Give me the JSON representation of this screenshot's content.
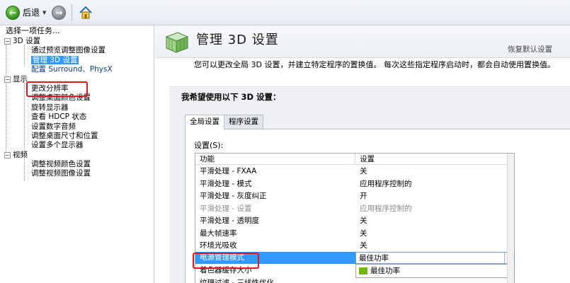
{
  "toolbar": {
    "back_label": "后退",
    "back_icon": "back-arrow-icon",
    "forward_icon": "forward-arrow-icon",
    "home_icon": "home-icon"
  },
  "left_panel": {
    "header": "选择一项任务...",
    "tree": [
      {
        "label": "3D 设置",
        "level": 0,
        "toggle": "−"
      },
      {
        "label": "通过预览调整图像设置",
        "level": 1
      },
      {
        "label": "管理 3D 设置",
        "level": 1,
        "selected": true
      },
      {
        "label": "配置 Surround、PhysX",
        "level": 1
      },
      {
        "label": "显示",
        "level": 0,
        "toggle": "−"
      },
      {
        "label": "更改分辨率",
        "level": 1
      },
      {
        "label": "调整桌面颜色设置",
        "level": 1
      },
      {
        "label": "旋转显示器",
        "level": 1
      },
      {
        "label": "查看 HDCP 状态",
        "level": 1
      },
      {
        "label": "设置数字音频",
        "level": 1
      },
      {
        "label": "调整桌面尺寸和位置",
        "level": 1
      },
      {
        "label": "设置多个显示器",
        "level": 1
      },
      {
        "label": "视频",
        "level": 0,
        "toggle": "−"
      },
      {
        "label": "调整视频颜色设置",
        "level": 1
      },
      {
        "label": "调整视频图像设置",
        "level": 1
      }
    ]
  },
  "right_panel": {
    "title": "管理 3D 设置",
    "restore_label": "恢复默认设置",
    "description": "您可以更改全局 3D 设置，并建立特定程序的置换值。 每次这些指定程序启动时，都会自动使用置换值。",
    "section_title": "我希望使用以下 3D 设置：",
    "tabs": [
      "全局设置",
      "程序设置"
    ],
    "settings_label": "设置(S):",
    "grid_headers": {
      "feature": "功能",
      "setting": "设置"
    },
    "rows": [
      {
        "feature": "平滑处理 - FXAA",
        "setting": "关"
      },
      {
        "feature": "平滑处理 - 模式",
        "setting": "应用程序控制的"
      },
      {
        "feature": "平滑处理 - 灰度纠正",
        "setting": "开"
      },
      {
        "feature": "平滑处理 - 设置",
        "setting": "应用程序控制的",
        "dim": true
      },
      {
        "feature": "平滑处理 - 透明度",
        "setting": "关"
      },
      {
        "feature": "最大帧速率",
        "setting": "关"
      },
      {
        "feature": "环境光吸收",
        "setting": "关"
      },
      {
        "feature": "电源管理模式",
        "setting": "最佳功率",
        "selected": true
      },
      {
        "feature": "着色器缓存大小",
        "setting": ""
      },
      {
        "feature": "纹理过滤 - 三线性优化",
        "setting": ""
      }
    ],
    "dropdown_option": "最佳功率"
  },
  "colors": {
    "selection": "#3399ff",
    "highlight_box": "#e0191f",
    "nvidia_green": "#76b900"
  }
}
